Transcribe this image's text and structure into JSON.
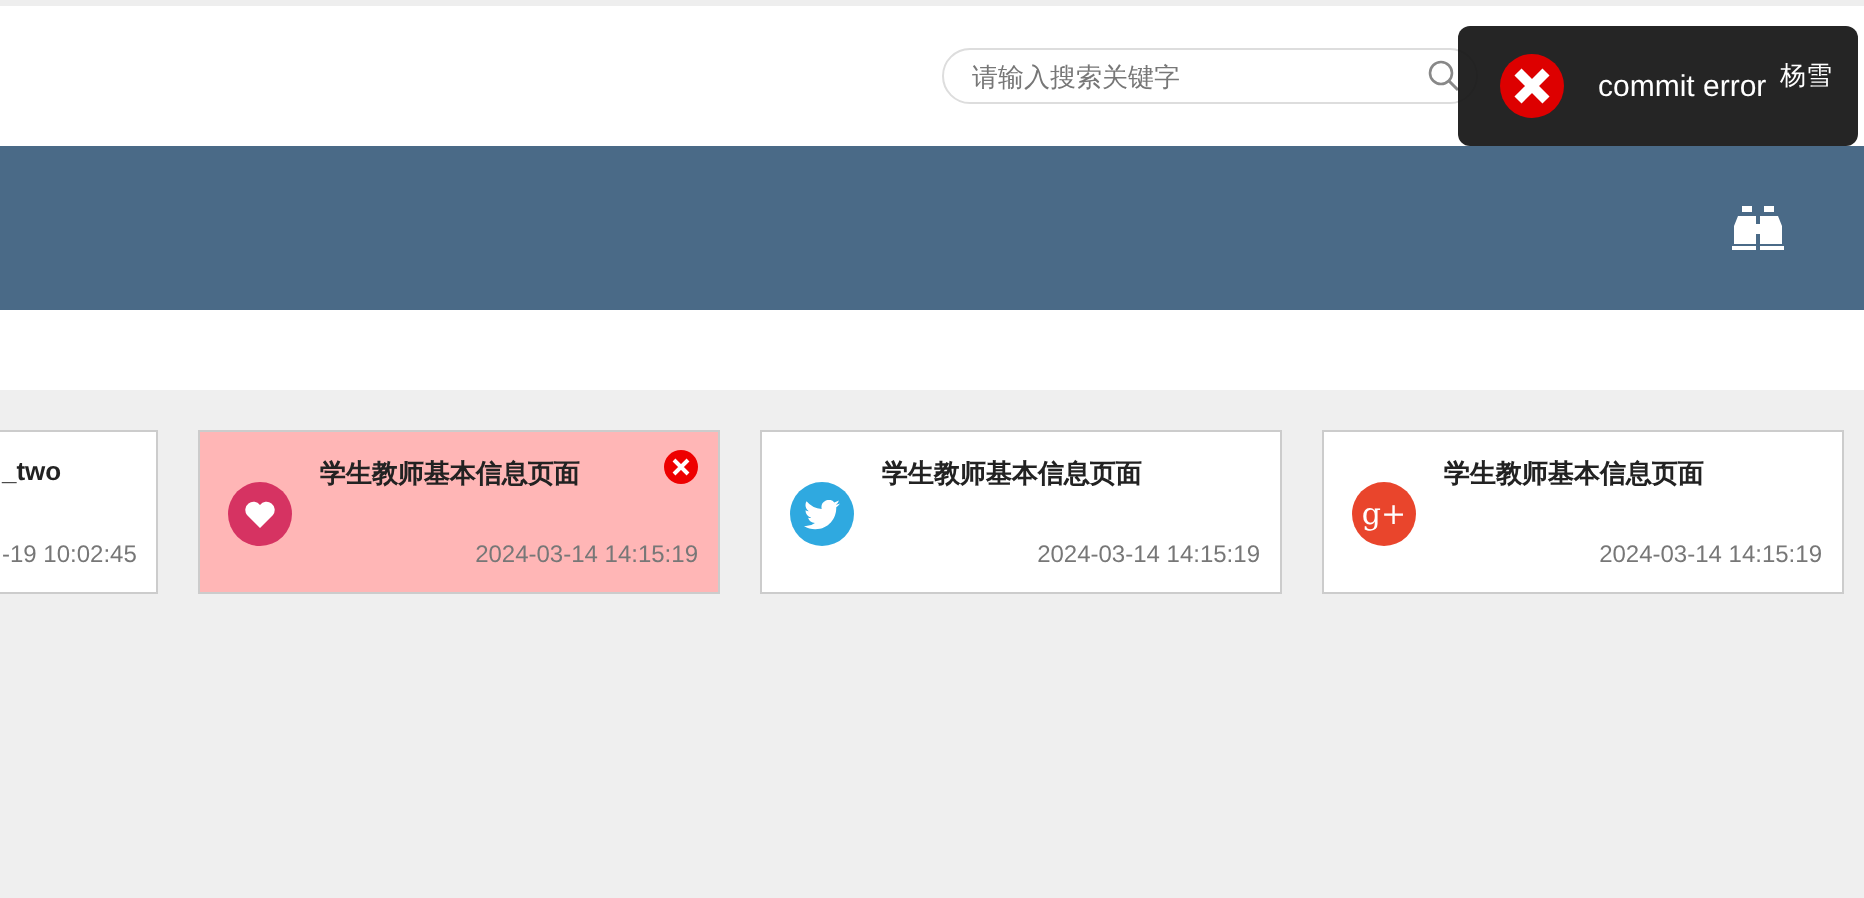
{
  "header": {
    "search": {
      "placeholder": "请输入搜索关键字"
    },
    "user": {
      "name": "杨雪"
    }
  },
  "toast": {
    "kind": "error",
    "message": "commit error"
  },
  "cards": [
    {
      "kind": "plain",
      "title": "_two",
      "time": "-19 10:02:45",
      "selected": false
    },
    {
      "kind": "heart",
      "title": "学生教师基本信息页面",
      "time": "2024-03-14 14:15:19",
      "selected": true
    },
    {
      "kind": "twitter",
      "title": "学生教师基本信息页面",
      "time": "2024-03-14 14:15:19",
      "selected": false
    },
    {
      "kind": "gplus",
      "icon_label": "g+",
      "title": "学生教师基本信息页面",
      "time": "2024-03-14 14:15:19",
      "selected": false
    }
  ]
}
